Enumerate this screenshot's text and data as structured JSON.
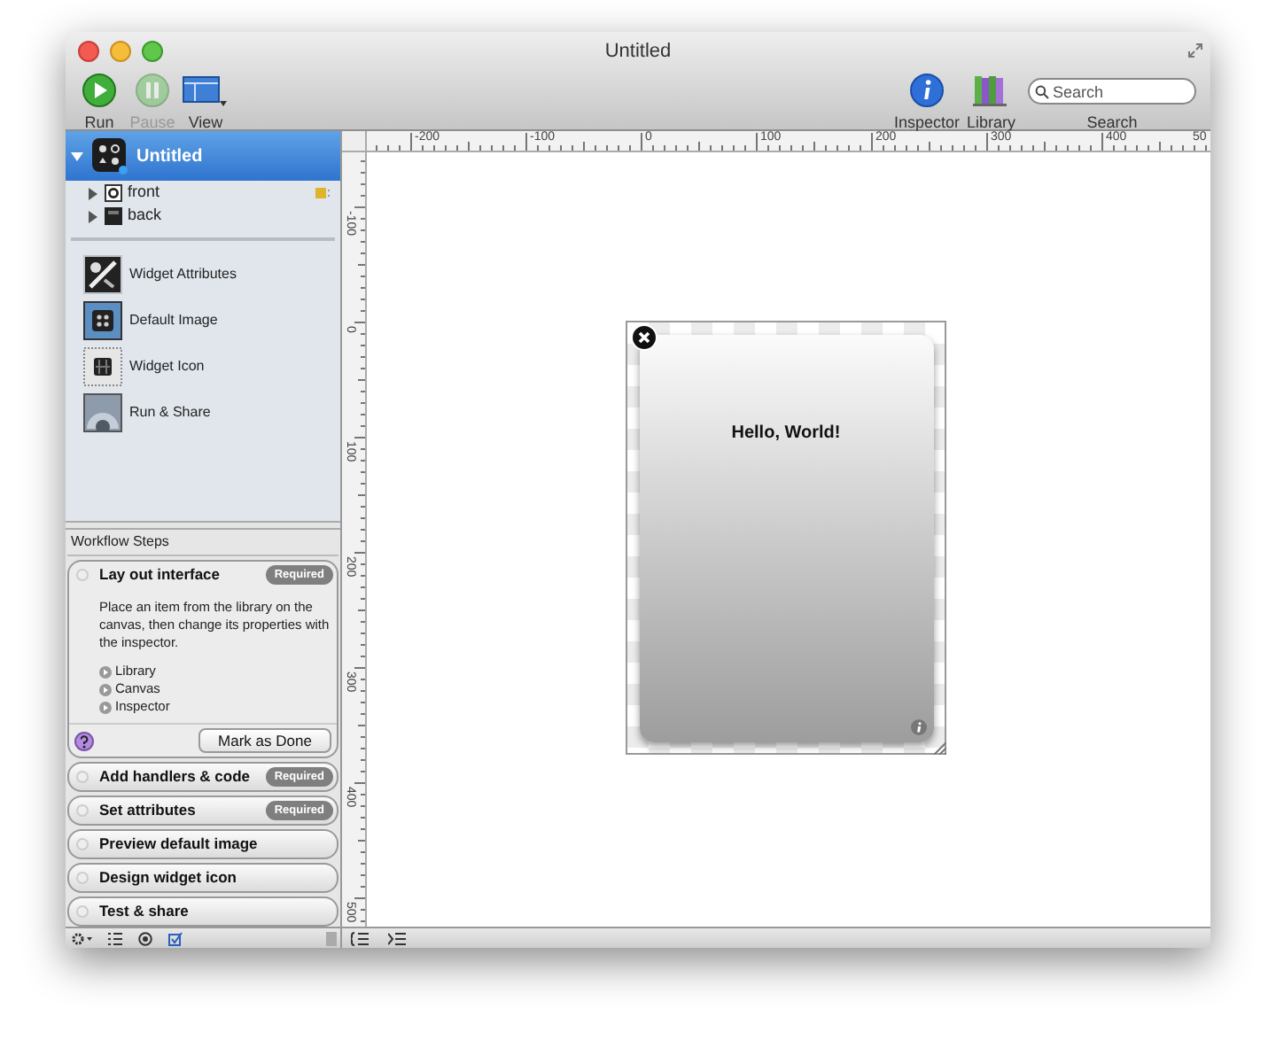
{
  "window": {
    "title": "Untitled"
  },
  "toolbar": {
    "left": [
      {
        "kind": "run",
        "label": "Run",
        "disabled": false
      },
      {
        "kind": "pause",
        "label": "Pause",
        "disabled": true
      },
      {
        "kind": "view",
        "label": "View",
        "disabled": false
      }
    ],
    "right": [
      {
        "kind": "inspector",
        "label": "Inspector"
      },
      {
        "kind": "library",
        "label": "Library"
      }
    ],
    "search": {
      "placeholder": "Search",
      "label": "Search"
    }
  },
  "project": {
    "title": "Untitled",
    "selected": true,
    "expanded": true,
    "children": [
      {
        "kind": "front",
        "label": "front",
        "expanded": false
      },
      {
        "kind": "back",
        "label": "back",
        "expanded": false
      }
    ]
  },
  "sections": [
    {
      "kind": "attributes",
      "label": "Widget Attributes"
    },
    {
      "kind": "image",
      "label": "Default Image"
    },
    {
      "kind": "icon",
      "label": "Widget Icon"
    },
    {
      "kind": "share",
      "label": "Run & Share"
    }
  ],
  "workflow": {
    "title": "Workflow Steps",
    "steps": [
      {
        "title": "Lay out interface",
        "badge": "Required",
        "expanded": true,
        "description": "Place an item from the library on the canvas, then change its properties with the inspector.",
        "links": [
          "Library",
          "Canvas",
          "Inspector"
        ],
        "action": "Mark as Done"
      },
      {
        "title": "Add handlers & code",
        "badge": "Required",
        "expanded": false
      },
      {
        "title": "Set attributes",
        "badge": "Required",
        "expanded": false
      },
      {
        "title": "Preview default image",
        "expanded": false
      },
      {
        "title": "Design widget icon",
        "expanded": false
      },
      {
        "title": "Test & share",
        "expanded": false
      }
    ]
  },
  "rulers": {
    "horizontal": [
      "-200",
      "-100",
      "0",
      "100",
      "200",
      "300",
      "400",
      "50"
    ],
    "vertical": [
      "-100",
      "0",
      "100",
      "200",
      "300",
      "400",
      "500"
    ]
  },
  "widget": {
    "text": "Hello, World!"
  }
}
